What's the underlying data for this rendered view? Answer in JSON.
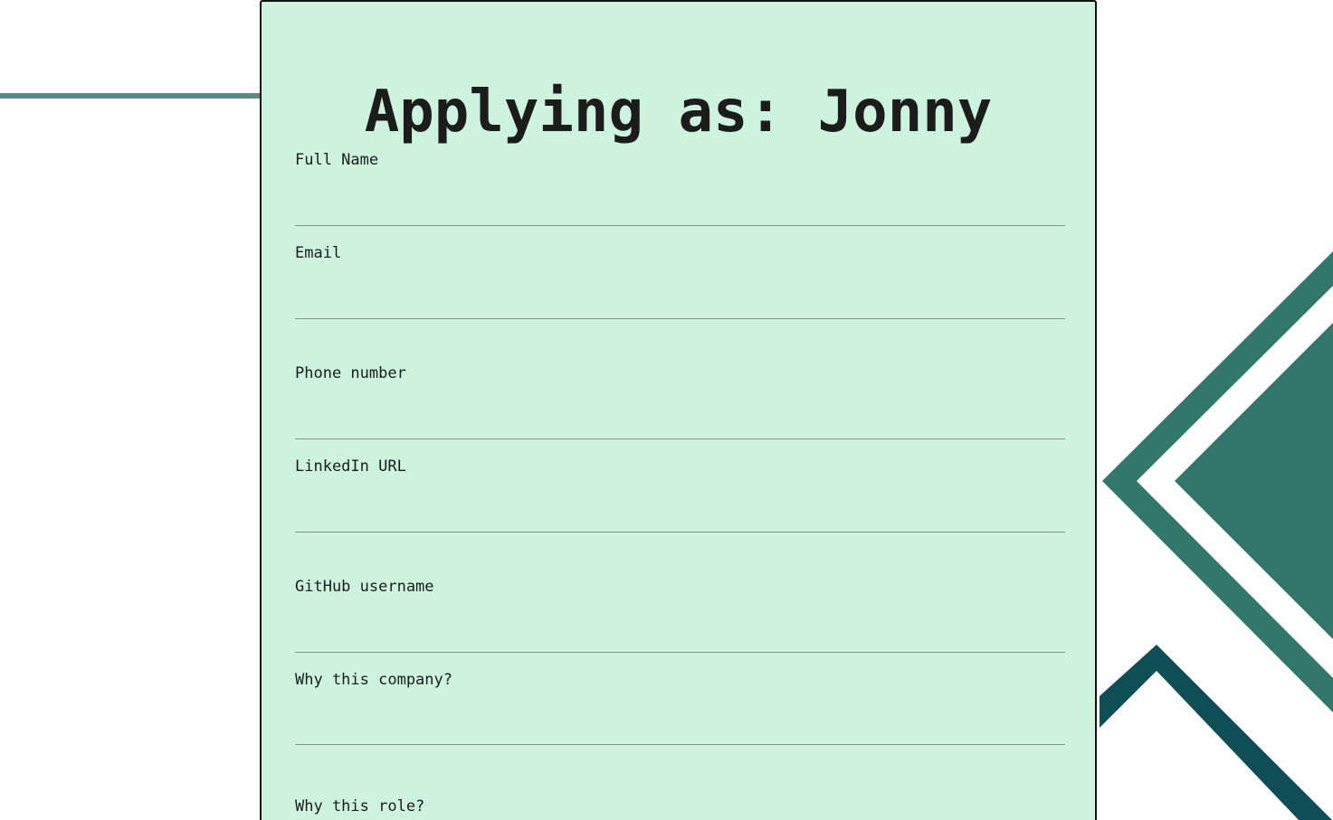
{
  "form": {
    "title": "Applying as: Jonny",
    "fields": [
      {
        "label": "Full Name",
        "value": ""
      },
      {
        "label": "Email",
        "value": ""
      },
      {
        "label": "Phone number",
        "value": ""
      },
      {
        "label": "LinkedIn URL",
        "value": ""
      },
      {
        "label": "GitHub username",
        "value": ""
      },
      {
        "label": "Why this company?",
        "value": ""
      },
      {
        "label": "Why this role?",
        "value": ""
      }
    ]
  },
  "colors": {
    "card_background": "#cdf3df",
    "accent_teal": "#33766c",
    "dark_teal": "#0f4d57",
    "line_teal": "#5a8a89"
  }
}
